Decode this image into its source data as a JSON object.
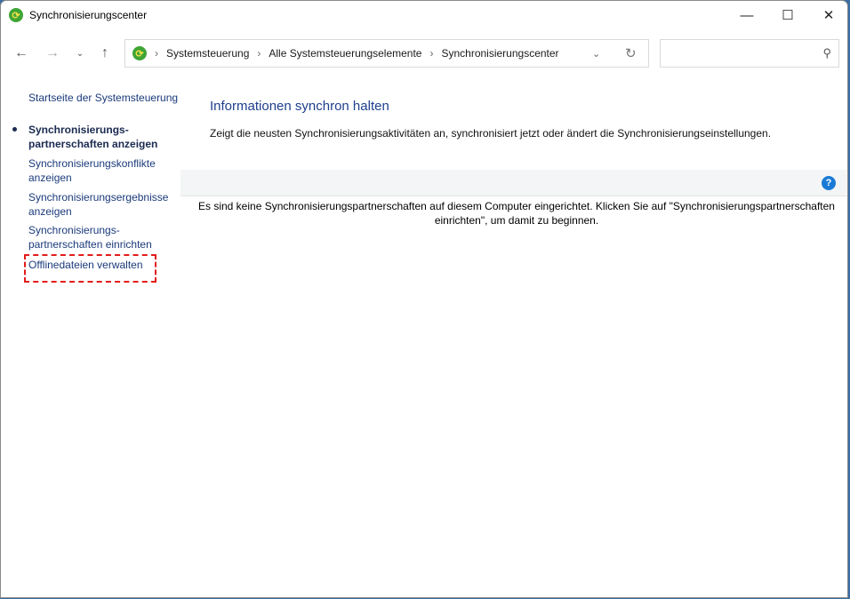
{
  "window": {
    "title": "Synchronisierungscenter"
  },
  "address": {
    "crumbs": [
      "Systemsteuerung",
      "Alle Systemsteuerungselemente",
      "Synchronisierungscenter"
    ]
  },
  "sidebar": {
    "home": "Startseite der Systemsteuerung",
    "items": [
      {
        "label1": "Synchronisierungs-",
        "label2": "partnerschaften anzeigen"
      },
      {
        "label1": "Synchronisierungskonflikte",
        "label2": "anzeigen"
      },
      {
        "label1": "Synchronisierungsergebnisse",
        "label2": "anzeigen"
      },
      {
        "label1": "Synchronisierungs-",
        "label2": "partnerschaften einrichten"
      },
      {
        "label1": "Offlinedateien verwalten"
      }
    ]
  },
  "main": {
    "heading": "Informationen synchron halten",
    "description": "Zeigt die neusten Synchronisierungsaktivitäten an, synchronisiert jetzt oder ändert die Synchronisierungseinstellungen.",
    "message": "Es sind keine Synchronisierungspartnerschaften auf diesem Computer eingerichtet. Klicken Sie auf \"Synchronisierungspartnerschaften einrichten\", um damit zu beginnen."
  }
}
